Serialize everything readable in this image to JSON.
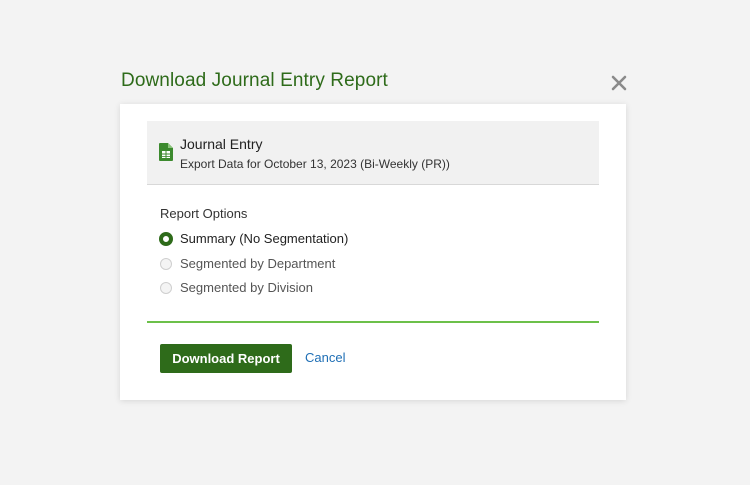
{
  "dialog": {
    "title": "Download Journal Entry Report",
    "close_icon": "close-icon"
  },
  "file": {
    "icon": "spreadsheet-file-icon",
    "icon_color": "#3c8a2e",
    "title": "Journal Entry",
    "subtitle": "Export Data for October 13, 2023 (Bi-Weekly (PR))"
  },
  "report_options": {
    "label": "Report Options",
    "options": [
      {
        "label": "Summary (No Segmentation)",
        "selected": true
      },
      {
        "label": "Segmented by Department",
        "selected": false
      },
      {
        "label": "Segmented by Division",
        "selected": false
      }
    ]
  },
  "actions": {
    "download_label": "Download Report",
    "cancel_label": "Cancel"
  },
  "colors": {
    "accent": "#2e6b1a",
    "divider": "#6cc04a",
    "link": "#1f6fb5",
    "background": "#f3f3f3"
  }
}
